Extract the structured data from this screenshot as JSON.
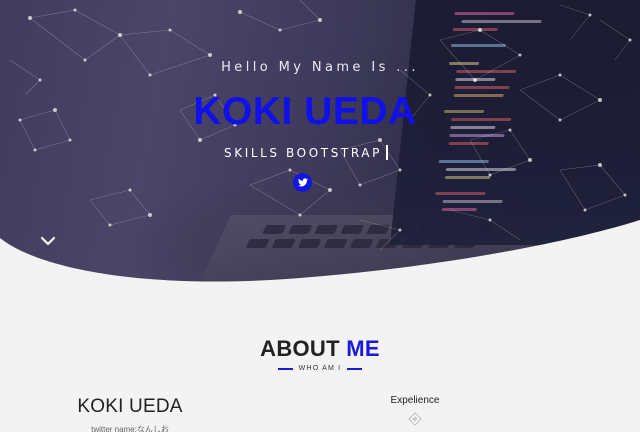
{
  "hero": {
    "greeting": "Hello My Name Is ...",
    "name": "KOKI UEDA",
    "skills": "SKILLS BOOTSTRAP",
    "social": [
      "twitter-icon"
    ],
    "scroll_icon": "chevron-down-icon"
  },
  "about": {
    "title_main": "ABOUT",
    "title_accent": "ME",
    "subtitle": "WHO AM I",
    "profile_name": "KOKI UEDA",
    "profile_twitter": "twitter name:なんしお",
    "experience_title": "Expelience"
  },
  "colors": {
    "accent": "#1a1ad8",
    "background": "#f3f3f3",
    "text": "#222222"
  }
}
